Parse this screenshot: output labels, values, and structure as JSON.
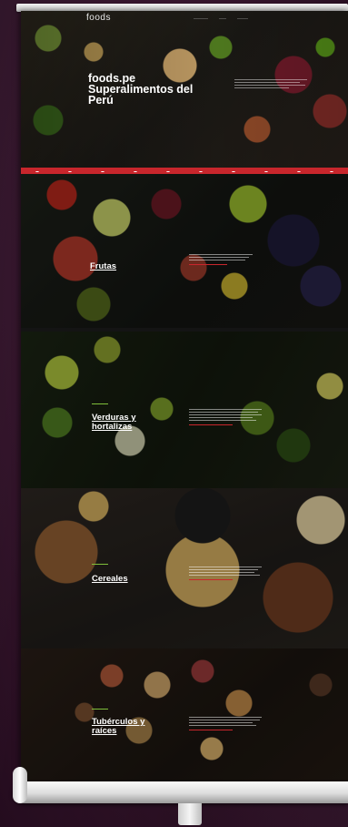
{
  "brand": "foods",
  "hero": {
    "title": "foods.pe Superalimentos del Perú"
  },
  "sections": {
    "frutas": {
      "title": "Frutas"
    },
    "verduras": {
      "title": "Verduras y hortalizas"
    },
    "cereales": {
      "title": "Cereales"
    },
    "tuberculos": {
      "title": "Tubérculos y raíces"
    }
  },
  "colors": {
    "accent_red": "#c8262c",
    "accent_green": "#7fbf3a",
    "backdrop": "#35142c"
  }
}
